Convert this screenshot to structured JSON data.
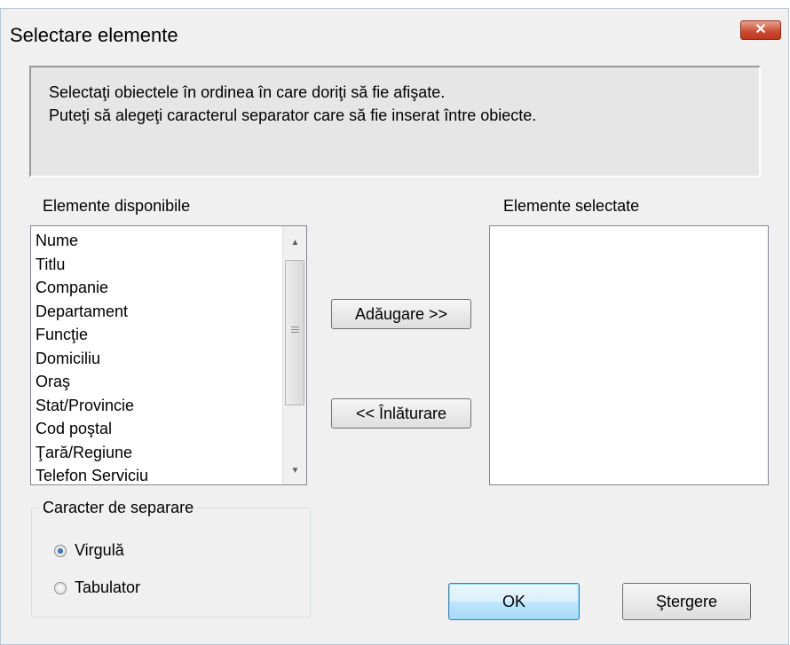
{
  "window": {
    "title": "Selectare elemente",
    "close_label": "✕"
  },
  "info": {
    "line1": "Selectaţi obiectele în ordinea în care doriţi să fie afişate.",
    "line2": "Puteţi să alegeţi caracterul separator care să fie inserat între obiecte."
  },
  "available": {
    "label": "Elemente disponibile",
    "items": [
      "Nume",
      "Titlu",
      "Companie",
      "Departament",
      "Funcţie",
      "Domiciliu",
      "Oraş",
      "Stat/Provincie",
      "Cod poştal",
      "Ţară/Regiune",
      "Telefon Serviciu"
    ]
  },
  "selected": {
    "label": "Elemente selectate",
    "items": []
  },
  "buttons": {
    "add": "Adăugare >>",
    "remove": "<< Înlăturare",
    "ok": "OK",
    "delete": "Ştergere"
  },
  "separator": {
    "title": "Caracter de separare",
    "options": [
      {
        "label": "Virgulă",
        "checked": true
      },
      {
        "label": "Tabulator",
        "checked": false
      }
    ]
  },
  "colors": {
    "dialog_bg": "#f0f0f0",
    "close_button": "#c9492f",
    "ok_border": "#3c7fb1",
    "radio_dot": "#1a4f8c"
  },
  "icons": {
    "scroll_up": "scroll-up-arrow-icon",
    "scroll_down": "scroll-down-arrow-icon",
    "close": "close-x-icon"
  }
}
